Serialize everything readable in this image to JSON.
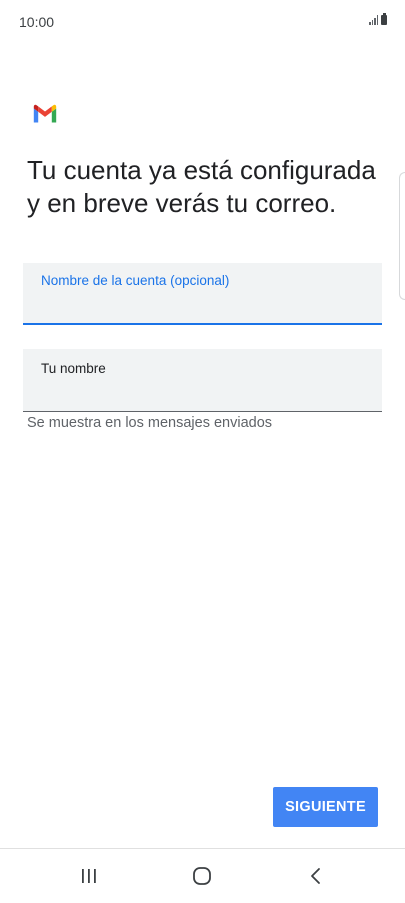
{
  "status_bar": {
    "time": "10:00"
  },
  "header": {
    "logo_icon": "gmail-logo-icon",
    "title": "Tu cuenta ya está configurada y en breve verás tu correo."
  },
  "form": {
    "account_name": {
      "label": "Nombre de la cuenta (opcional)",
      "value": ""
    },
    "your_name": {
      "label": "Tu nombre",
      "value": "",
      "helper": "Se muestra en los mensajes enviados"
    }
  },
  "actions": {
    "next_label": "SIGUIENTE"
  },
  "navigation": {
    "recents_icon": "recents-icon",
    "home_icon": "home-icon",
    "back_icon": "back-icon"
  },
  "colors": {
    "accent": "#1a73e8",
    "button": "#4285f4",
    "field_background": "#f1f3f4"
  }
}
